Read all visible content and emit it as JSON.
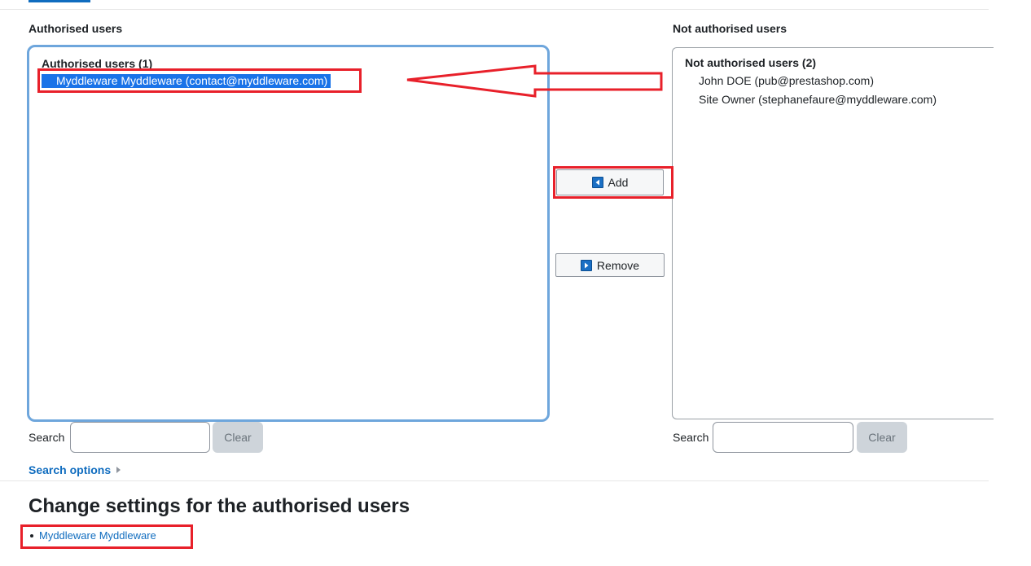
{
  "authorised": {
    "heading": "Authorised users",
    "group_label": "Authorised users (1)",
    "options": [
      {
        "label": "Myddleware Myddleware (contact@myddleware.com)",
        "selected": true
      }
    ]
  },
  "not_authorised": {
    "heading": "Not authorised users",
    "group_label": "Not authorised users (2)",
    "options": [
      {
        "label": "John DOE (pub@prestashop.com)"
      },
      {
        "label": "Site Owner (stephanefaure@myddleware.com)"
      }
    ]
  },
  "actions": {
    "add_label": "Add",
    "remove_label": "Remove"
  },
  "search_left": {
    "label": "Search",
    "value": "",
    "clear_label": "Clear"
  },
  "search_right": {
    "label": "Search",
    "value": "",
    "clear_label": "Clear"
  },
  "search_options": {
    "label": "Search options"
  },
  "settings": {
    "title": "Change settings for the authorised users",
    "users": [
      "Myddleware Myddleware"
    ]
  },
  "colors": {
    "accent": "#0f6cbf",
    "selection": "#1a73e8",
    "annotation_red": "#e8202a"
  }
}
